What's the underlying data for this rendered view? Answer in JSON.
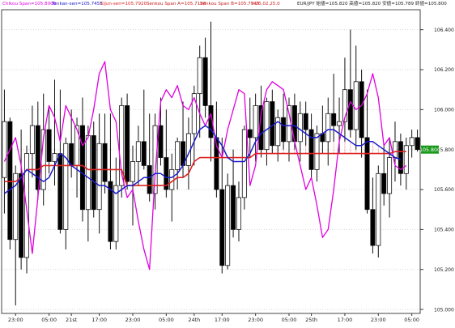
{
  "header": {
    "chikou": "Chikou Span=105.8000",
    "tenkan": "Tenkan-sen=105.7455",
    "kijun": "Kijun-sen=105.7920",
    "senkou_a": "Senkou Span A=105.7188",
    "senkou_b": "Senkou Span B=105.7945",
    "time": "9:26,02,25.0",
    "quote": "EUR/JPY 始値=105.820 高値=105.820 安値=105.789 終値=105.800",
    "colors": {
      "chikou": "#e000e0",
      "tenkan": "#1a1acc",
      "kijun": "#dd2222",
      "senkou_a": "#c81e1e",
      "senkou_b": "#c81e1e",
      "time": "#cc2222",
      "quote": "#222222"
    }
  },
  "chart_data": {
    "type": "candlestick",
    "title": "",
    "symbol": "EUR/JPY",
    "ylim": [
      104.98,
      106.5
    ],
    "y_ticks": [
      "106.400",
      "106.200",
      "106.000",
      "105.800",
      "105.600",
      "105.400",
      "105.200",
      "105.000"
    ],
    "x_labels": [
      {
        "label": "23:00",
        "index": 2
      },
      {
        "label": "05:00",
        "index": 8
      },
      {
        "label": "21st",
        "index": 12
      },
      {
        "label": "17:00",
        "index": 17
      },
      {
        "label": "23:00",
        "index": 23
      },
      {
        "label": "05:00",
        "index": 29
      },
      {
        "label": "24th",
        "index": 34
      },
      {
        "label": "17:00",
        "index": 39
      },
      {
        "label": "23:00",
        "index": 45
      },
      {
        "label": "05:00",
        "index": 51
      },
      {
        "label": "25th",
        "index": 55
      },
      {
        "label": "17:00",
        "index": 61
      },
      {
        "label": "23:00",
        "index": 67
      },
      {
        "label": "05:00",
        "index": 73
      }
    ],
    "current_price": "105.800",
    "candles": [
      [
        105.66,
        106.1,
        105.48,
        105.94
      ],
      [
        105.94,
        105.96,
        105.3,
        105.35
      ],
      [
        105.35,
        105.72,
        105.02,
        105.68
      ],
      [
        105.68,
        105.9,
        105.2,
        105.26
      ],
      [
        105.26,
        105.82,
        105.18,
        105.78
      ],
      [
        105.78,
        106.02,
        105.66,
        105.92
      ],
      [
        105.92,
        106.04,
        105.55,
        105.6
      ],
      [
        105.6,
        106.08,
        105.52,
        105.9
      ],
      [
        105.9,
        106.02,
        105.68,
        105.74
      ],
      [
        105.74,
        106.15,
        105.62,
        105.78
      ],
      [
        105.78,
        106.1,
        105.38,
        105.4
      ],
      [
        105.4,
        105.86,
        105.3,
        105.83
      ],
      [
        105.83,
        106.0,
        105.66,
        105.72
      ],
      [
        105.72,
        105.96,
        105.56,
        105.92
      ],
      [
        105.92,
        106.06,
        105.44,
        105.5
      ],
      [
        105.5,
        105.92,
        105.34,
        105.87
      ],
      [
        105.87,
        105.94,
        105.46,
        105.5
      ],
      [
        105.5,
        105.98,
        105.38,
        105.83
      ],
      [
        105.83,
        105.98,
        105.58,
        105.64
      ],
      [
        105.64,
        105.98,
        105.3,
        105.34
      ],
      [
        105.34,
        105.76,
        105.3,
        105.62
      ],
      [
        105.62,
        106.06,
        105.56,
        106.02
      ],
      [
        106.02,
        106.08,
        105.6,
        105.64
      ],
      [
        105.64,
        105.82,
        105.42,
        105.74
      ],
      [
        105.74,
        105.92,
        105.62,
        105.84
      ],
      [
        105.84,
        106.1,
        105.7,
        105.72
      ],
      [
        105.72,
        105.98,
        105.54,
        105.58
      ],
      [
        105.58,
        105.98,
        105.5,
        105.92
      ],
      [
        105.92,
        106.06,
        105.72,
        105.76
      ],
      [
        105.76,
        106.0,
        105.56,
        105.6
      ],
      [
        105.6,
        105.78,
        105.44,
        105.7
      ],
      [
        105.7,
        105.86,
        105.6,
        105.84
      ],
      [
        105.84,
        106.04,
        105.66,
        105.72
      ],
      [
        105.72,
        105.96,
        105.6,
        105.88
      ],
      [
        105.88,
        106.12,
        105.72,
        106.08
      ],
      [
        106.08,
        106.32,
        105.86,
        106.26
      ],
      [
        106.26,
        106.36,
        105.96,
        106.02
      ],
      [
        106.02,
        106.44,
        105.74,
        105.86
      ],
      [
        105.86,
        106.04,
        105.56,
        105.6
      ],
      [
        105.6,
        105.86,
        105.18,
        105.22
      ],
      [
        105.22,
        105.68,
        105.2,
        105.62
      ],
      [
        105.62,
        105.8,
        105.36,
        105.4
      ],
      [
        105.4,
        105.64,
        105.34,
        105.56
      ],
      [
        105.56,
        105.92,
        105.5,
        105.9
      ],
      [
        105.9,
        106.06,
        105.76,
        105.86
      ],
      [
        105.86,
        106.08,
        105.74,
        106.02
      ],
      [
        106.02,
        106.12,
        105.76,
        105.8
      ],
      [
        105.8,
        106.06,
        105.72,
        106.04
      ],
      [
        106.04,
        106.1,
        105.78,
        105.82
      ],
      [
        105.82,
        106.0,
        105.74,
        105.96
      ],
      [
        105.96,
        106.08,
        105.8,
        105.84
      ],
      [
        105.84,
        106.06,
        105.74,
        106.02
      ],
      [
        106.02,
        106.08,
        105.8,
        105.84
      ],
      [
        105.84,
        106.04,
        105.74,
        105.98
      ],
      [
        105.98,
        106.04,
        105.82,
        105.9
      ],
      [
        105.9,
        105.98,
        105.66,
        105.7
      ],
      [
        105.7,
        105.92,
        105.64,
        105.88
      ],
      [
        105.88,
        106.02,
        105.78,
        105.84
      ],
      [
        105.84,
        106.06,
        105.72,
        105.98
      ],
      [
        105.98,
        106.18,
        105.84,
        105.92
      ],
      [
        105.92,
        106.06,
        105.78,
        105.94
      ],
      [
        105.94,
        106.26,
        105.84,
        106.1
      ],
      [
        106.1,
        106.4,
        105.86,
        105.9
      ],
      [
        105.9,
        106.32,
        105.8,
        106.14
      ],
      [
        106.14,
        106.2,
        105.76,
        105.86
      ],
      [
        105.86,
        106.1,
        105.48,
        105.5
      ],
      [
        105.5,
        105.66,
        105.28,
        105.32
      ],
      [
        105.32,
        105.72,
        105.26,
        105.68
      ],
      [
        105.68,
        105.82,
        105.52,
        105.58
      ],
      [
        105.58,
        105.86,
        105.46,
        105.76
      ],
      [
        105.76,
        105.94,
        105.64,
        105.84
      ],
      [
        105.84,
        105.88,
        105.62,
        105.68
      ],
      [
        105.68,
        105.86,
        105.6,
        105.82
      ],
      [
        105.82,
        105.9,
        105.76,
        105.86
      ],
      [
        105.86,
        105.9,
        105.79,
        105.8
      ]
    ],
    "chikou_span": [
      [
        0,
        105.74
      ],
      [
        1,
        105.8
      ],
      [
        2,
        105.86
      ],
      [
        3,
        105.72
      ],
      [
        4,
        105.5
      ],
      [
        5,
        105.28
      ],
      [
        6,
        105.56
      ],
      [
        7,
        105.86
      ],
      [
        8,
        106.02
      ],
      [
        9,
        105.96
      ],
      [
        10,
        105.84
      ],
      [
        11,
        106.02
      ],
      [
        12,
        105.96
      ],
      [
        13,
        105.9
      ],
      [
        14,
        105.82
      ],
      [
        15,
        105.86
      ],
      [
        16,
        106.0
      ],
      [
        17,
        106.18
      ],
      [
        18,
        106.24
      ],
      [
        19,
        106.0
      ],
      [
        20,
        105.94
      ],
      [
        21,
        105.68
      ],
      [
        22,
        105.56
      ],
      [
        23,
        105.6
      ],
      [
        24,
        105.44
      ],
      [
        25,
        105.3
      ],
      [
        26,
        105.2
      ],
      [
        27,
        105.68
      ],
      [
        28,
        106.04
      ],
      [
        29,
        106.1
      ],
      [
        30,
        106.06
      ],
      [
        31,
        106.12
      ],
      [
        32,
        106.02
      ],
      [
        33,
        106.0
      ],
      [
        34,
        106.06
      ],
      [
        35,
        105.98
      ],
      [
        36,
        105.92
      ],
      [
        37,
        105.98
      ],
      [
        38,
        105.82
      ],
      [
        39,
        105.76
      ],
      [
        40,
        105.9
      ],
      [
        41,
        106.0
      ],
      [
        42,
        106.1
      ],
      [
        43,
        106.08
      ],
      [
        44,
        105.62
      ],
      [
        45,
        105.72
      ],
      [
        46,
        105.98
      ],
      [
        47,
        106.1
      ],
      [
        48,
        106.14
      ],
      [
        49,
        106.12
      ],
      [
        50,
        106.1
      ],
      [
        51,
        105.98
      ],
      [
        52,
        105.84
      ],
      [
        53,
        105.72
      ],
      [
        54,
        105.6
      ],
      [
        55,
        105.66
      ],
      [
        56,
        105.52
      ],
      [
        57,
        105.36
      ],
      [
        58,
        105.4
      ],
      [
        59,
        105.6
      ],
      [
        60,
        105.84
      ],
      [
        61,
        105.96
      ],
      [
        62,
        106.04
      ],
      [
        63,
        106.0
      ],
      [
        64,
        106.02
      ],
      [
        65,
        106.08
      ],
      [
        66,
        106.18
      ],
      [
        67,
        106.06
      ],
      [
        68,
        105.82
      ],
      [
        69,
        105.86
      ],
      [
        70,
        105.72
      ],
      [
        71,
        105.7
      ],
      [
        72,
        105.72
      ]
    ],
    "tenkan_sen": [
      [
        0,
        105.58
      ],
      [
        1,
        105.6
      ],
      [
        2,
        105.62
      ],
      [
        3,
        105.66
      ],
      [
        4,
        105.7
      ],
      [
        5,
        105.68
      ],
      [
        6,
        105.66
      ],
      [
        7,
        105.64
      ],
      [
        8,
        105.66
      ],
      [
        9,
        105.72
      ],
      [
        10,
        105.78
      ],
      [
        11,
        105.76
      ],
      [
        12,
        105.72
      ],
      [
        13,
        105.7
      ],
      [
        14,
        105.68
      ],
      [
        15,
        105.66
      ],
      [
        16,
        105.64
      ],
      [
        17,
        105.62
      ],
      [
        18,
        105.62
      ],
      [
        19,
        105.6
      ],
      [
        20,
        105.58
      ],
      [
        21,
        105.6
      ],
      [
        22,
        105.62
      ],
      [
        23,
        105.62
      ],
      [
        24,
        105.64
      ],
      [
        25,
        105.66
      ],
      [
        26,
        105.66
      ],
      [
        27,
        105.68
      ],
      [
        28,
        105.68
      ],
      [
        29,
        105.66
      ],
      [
        30,
        105.66
      ],
      [
        31,
        105.68
      ],
      [
        32,
        105.72
      ],
      [
        33,
        105.78
      ],
      [
        34,
        105.84
      ],
      [
        35,
        105.9
      ],
      [
        36,
        105.92
      ],
      [
        37,
        105.9
      ],
      [
        38,
        105.86
      ],
      [
        39,
        105.82
      ],
      [
        40,
        105.76
      ],
      [
        41,
        105.74
      ],
      [
        42,
        105.74
      ],
      [
        43,
        105.74
      ],
      [
        44,
        105.78
      ],
      [
        45,
        105.84
      ],
      [
        46,
        105.88
      ],
      [
        47,
        105.9
      ],
      [
        48,
        105.92
      ],
      [
        49,
        105.94
      ],
      [
        50,
        105.92
      ],
      [
        51,
        105.92
      ],
      [
        52,
        105.92
      ],
      [
        53,
        105.9
      ],
      [
        54,
        105.88
      ],
      [
        55,
        105.86
      ],
      [
        56,
        105.86
      ],
      [
        57,
        105.88
      ],
      [
        58,
        105.9
      ],
      [
        59,
        105.9
      ],
      [
        60,
        105.88
      ],
      [
        61,
        105.86
      ],
      [
        62,
        105.84
      ],
      [
        63,
        105.82
      ],
      [
        64,
        105.82
      ],
      [
        65,
        105.84
      ],
      [
        66,
        105.84
      ],
      [
        67,
        105.82
      ],
      [
        68,
        105.8
      ],
      [
        69,
        105.78
      ],
      [
        70,
        105.76
      ],
      [
        71,
        105.75
      ]
    ],
    "kijun_sen": [
      [
        0,
        105.64
      ],
      [
        1,
        105.64
      ],
      [
        2,
        105.64
      ],
      [
        3,
        105.66
      ],
      [
        4,
        105.7
      ],
      [
        5,
        105.7
      ],
      [
        6,
        105.7
      ],
      [
        7,
        105.72
      ],
      [
        8,
        105.72
      ],
      [
        9,
        105.72
      ],
      [
        10,
        105.72
      ],
      [
        11,
        105.72
      ],
      [
        12,
        105.72
      ],
      [
        13,
        105.72
      ],
      [
        14,
        105.72
      ],
      [
        15,
        105.7
      ],
      [
        16,
        105.7
      ],
      [
        17,
        105.7
      ],
      [
        18,
        105.7
      ],
      [
        19,
        105.7
      ],
      [
        20,
        105.7
      ],
      [
        21,
        105.7
      ],
      [
        22,
        105.62
      ],
      [
        23,
        105.62
      ],
      [
        24,
        105.62
      ],
      [
        25,
        105.62
      ],
      [
        26,
        105.62
      ],
      [
        27,
        105.62
      ],
      [
        28,
        105.62
      ],
      [
        29,
        105.62
      ],
      [
        30,
        105.64
      ],
      [
        31,
        105.66
      ],
      [
        32,
        105.66
      ],
      [
        33,
        105.68
      ],
      [
        34,
        105.74
      ],
      [
        35,
        105.76
      ],
      [
        36,
        105.76
      ],
      [
        37,
        105.76
      ],
      [
        38,
        105.76
      ],
      [
        39,
        105.76
      ],
      [
        40,
        105.76
      ],
      [
        41,
        105.76
      ],
      [
        42,
        105.76
      ],
      [
        43,
        105.76
      ],
      [
        44,
        105.76
      ],
      [
        45,
        105.78
      ],
      [
        46,
        105.78
      ],
      [
        47,
        105.78
      ],
      [
        48,
        105.78
      ],
      [
        49,
        105.78
      ],
      [
        50,
        105.78
      ],
      [
        51,
        105.78
      ],
      [
        52,
        105.78
      ],
      [
        53,
        105.78
      ],
      [
        54,
        105.78
      ],
      [
        55,
        105.78
      ],
      [
        56,
        105.78
      ],
      [
        57,
        105.78
      ],
      [
        58,
        105.78
      ],
      [
        59,
        105.78
      ],
      [
        60,
        105.78
      ],
      [
        61,
        105.78
      ],
      [
        62,
        105.78
      ],
      [
        63,
        105.78
      ],
      [
        64,
        105.78
      ],
      [
        65,
        105.78
      ],
      [
        66,
        105.78
      ],
      [
        67,
        105.78
      ],
      [
        68,
        105.78
      ],
      [
        69,
        105.78
      ],
      [
        70,
        105.79
      ],
      [
        71,
        105.79
      ],
      [
        72,
        105.79
      ]
    ],
    "cloud_hatch_ranges": [
      [
        2,
        18
      ],
      [
        43,
        74
      ]
    ]
  }
}
